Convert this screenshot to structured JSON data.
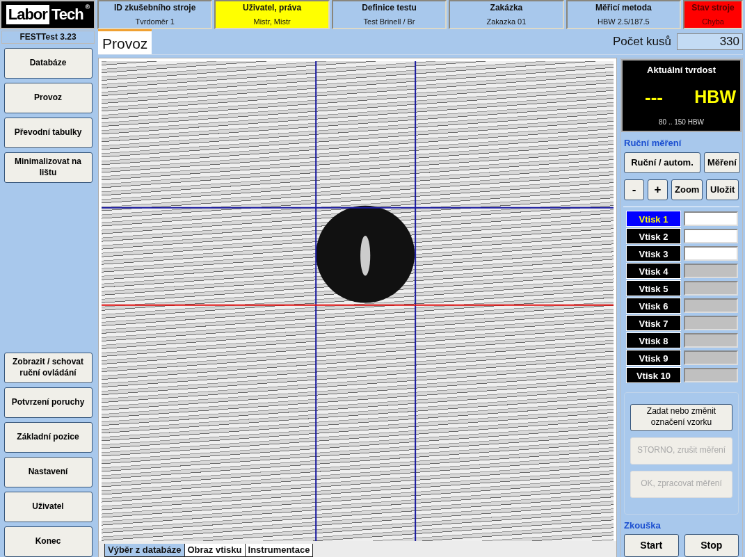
{
  "logo": {
    "word1": "Labor",
    "word2": "Tech",
    "mark": "®"
  },
  "header": [
    {
      "label": "ID zkušebního stroje",
      "value": "Tvrdoměr 1",
      "color": "#a8c8ec",
      "alert": false
    },
    {
      "label": "Uživatel, práva",
      "value": "Mistr, Mistr",
      "color": "#ffff00",
      "alert": false
    },
    {
      "label": "Definice testu",
      "value": "Test Brinell / Br",
      "color": "#a8c8ec",
      "alert": false
    },
    {
      "label": "Zakázka",
      "value": "Zakazka 01",
      "color": "#a8c8ec",
      "alert": false
    },
    {
      "label": "Měřicí metoda",
      "value": "HBW 2.5/187.5",
      "color": "#a8c8ec",
      "alert": false
    },
    {
      "label": "Stav stroje",
      "value": "Chyba",
      "color": "#ff0000",
      "alert": true
    }
  ],
  "app_version": "FESTTest 3.23",
  "sidebar": {
    "top_buttons": [
      "Databáze",
      "Provoz",
      "Převodní tabulky",
      "Minimalizovat na lištu"
    ],
    "bottom_buttons": [
      "Zobrazit / schovat ruční ovládání",
      "Potvrzení poruchy",
      "Základní pozice",
      "Nastavení",
      "Uživatel",
      "Konec"
    ]
  },
  "page_tab": "Provoz",
  "piece_count": {
    "label": "Počet kusů",
    "value": "330"
  },
  "bottom_tabs": [
    {
      "label": "Výběr z databáze",
      "selected": true
    },
    {
      "label": "Obraz vtisku",
      "selected": false
    },
    {
      "label": "Instrumentace",
      "selected": false
    }
  ],
  "hardness": {
    "title": "Aktuální tvrdost",
    "value": "---",
    "unit": "HBW",
    "range": "80 .. 150 HBW"
  },
  "manual": {
    "title": "Ruční měření",
    "mode_buttons": [
      "Ruční / autom.",
      "Měření"
    ],
    "view_buttons": [
      "-",
      "+",
      "Zoom",
      "Uložit"
    ]
  },
  "indents": [
    {
      "label": "Vtisk 1",
      "selected": true,
      "disabled": false
    },
    {
      "label": "Vtisk 2",
      "selected": false,
      "disabled": false
    },
    {
      "label": "Vtisk 3",
      "selected": false,
      "disabled": false
    },
    {
      "label": "Vtisk 4",
      "selected": false,
      "disabled": true
    },
    {
      "label": "Vtisk 5",
      "selected": false,
      "disabled": true
    },
    {
      "label": "Vtisk 6",
      "selected": false,
      "disabled": true
    },
    {
      "label": "Vtisk 7",
      "selected": false,
      "disabled": true
    },
    {
      "label": "Vtisk 8",
      "selected": false,
      "disabled": true
    },
    {
      "label": "Vtisk 9",
      "selected": false,
      "disabled": true
    },
    {
      "label": "Vtisk 10",
      "selected": false,
      "disabled": true
    }
  ],
  "sample_buttons": [
    {
      "label": "Zadat nebo změnit označení vzorku",
      "disabled": false
    },
    {
      "label": "STORNO, zrušit měření",
      "disabled": true
    },
    {
      "label": "OK, zpracovat měření",
      "disabled": true
    }
  ],
  "test": {
    "title": "Zkouška",
    "buttons": [
      "Start",
      "Stop"
    ]
  }
}
